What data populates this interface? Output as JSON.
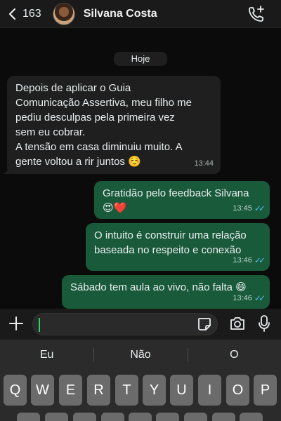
{
  "header": {
    "back_count": "163",
    "contact_name": "Silvana Costa"
  },
  "chat": {
    "day_label": "Hoje",
    "messages": [
      {
        "direction": "incoming",
        "lines": [
          "Depois de aplicar o Guia",
          "Comunicação Assertiva, meu filho me",
          "pediu desculpas pela primeira vez",
          "sem eu cobrar.",
          "A tensão em casa diminuiu muito. A",
          "gente voltou a rir juntos ☺️"
        ],
        "time": "13:44"
      },
      {
        "direction": "outgoing",
        "lines": [
          "Gratidão pelo feedback Silvana",
          "😍❤️"
        ],
        "time": "13:45",
        "status": "read"
      },
      {
        "direction": "outgoing",
        "lines": [
          "O intuito é construir uma relação",
          "baseada no respeito e conexão"
        ],
        "time": "13:46",
        "status": "read"
      },
      {
        "direction": "outgoing",
        "lines": [
          "Sábado tem aula ao vivo, não falta 😄"
        ],
        "time": "13:46",
        "status": "read"
      }
    ]
  },
  "input": {
    "value": "",
    "icons": [
      "plus-icon",
      "sticker-icon",
      "camera-icon",
      "mic-icon"
    ]
  },
  "keyboard": {
    "suggestions": [
      "Eu",
      "Não",
      "O"
    ],
    "top_row": [
      "Q",
      "W",
      "E",
      "R",
      "T",
      "Y",
      "U",
      "I",
      "O",
      "P"
    ]
  },
  "colors": {
    "outgoing_bubble": "#195a3b",
    "incoming_bubble": "#1f1f1f",
    "read_ticks": "#53bdeb",
    "accent": "#25d366"
  }
}
